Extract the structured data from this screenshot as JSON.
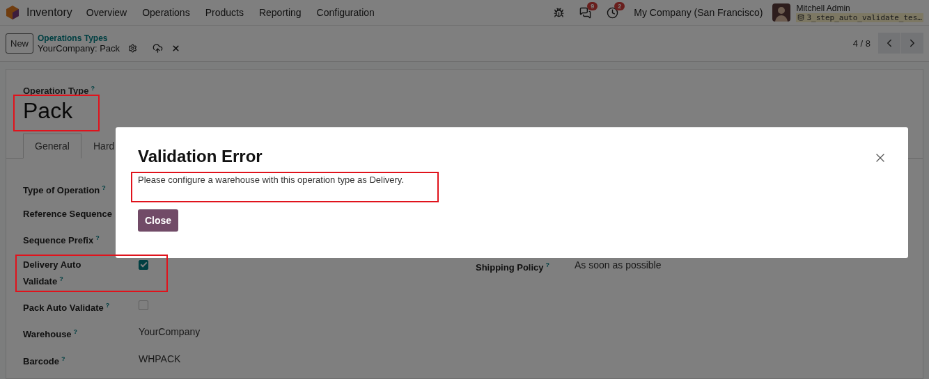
{
  "navbar": {
    "app": "Inventory",
    "menu": [
      "Overview",
      "Operations",
      "Products",
      "Reporting",
      "Configuration"
    ],
    "messages_badge": "9",
    "activities_badge": "2",
    "company": "My Company (San Francisco)",
    "user": "Mitchell Admin",
    "database": "3_step_auto_validate_tes…"
  },
  "control_panel": {
    "new_button": "New",
    "breadcrumb": "Operations Types",
    "record": "YourCompany: Pack",
    "pager": "4 / 8"
  },
  "form": {
    "title_label": "Operation Type",
    "title_help": "?",
    "title": "Pack",
    "title_highlighted": true,
    "tabs": [
      {
        "label": "General",
        "selected": true
      },
      {
        "label": "Hard",
        "selected": false
      }
    ],
    "rows": [
      {
        "left": {
          "label": "Type of Operation",
          "help": "?",
          "kind": "hidden"
        }
      },
      {
        "left": {
          "label": "Reference Sequence",
          "kind": "hidden"
        }
      },
      {
        "left": {
          "label": "Sequence Prefix",
          "help": "?",
          "kind": "hidden"
        }
      },
      {
        "highlighted": true,
        "left": {
          "label": "Delivery Auto Validate",
          "help": "?",
          "kind": "checkbox",
          "checked": true
        },
        "right": {
          "label": "Shipping Policy",
          "help": "?",
          "kind": "text",
          "value": "As soon as possible"
        }
      },
      {
        "left": {
          "label": "Pack Auto Validate",
          "help": "?",
          "kind": "checkbox",
          "checked": false
        }
      },
      {
        "left": {
          "label": "Warehouse",
          "help": "?",
          "kind": "text",
          "value": "YourCompany"
        }
      },
      {
        "left": {
          "label": "Barcode",
          "help": "?",
          "kind": "text",
          "value": "WHPACK"
        }
      }
    ]
  },
  "dialog": {
    "title": "Validation Error",
    "message": "Please configure a warehouse with this operation type as Delivery.",
    "message_highlighted": true,
    "close_button": "Close"
  }
}
